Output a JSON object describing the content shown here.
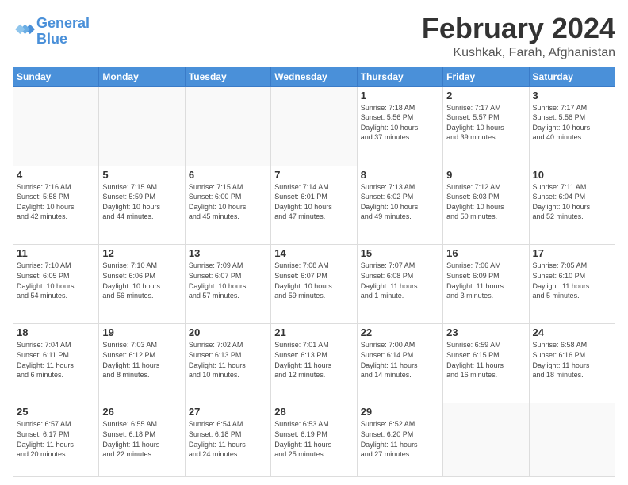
{
  "header": {
    "logo_line1": "General",
    "logo_line2": "Blue",
    "month_title": "February 2024",
    "location": "Kushkak, Farah, Afghanistan"
  },
  "calendar": {
    "days_of_week": [
      "Sunday",
      "Monday",
      "Tuesday",
      "Wednesday",
      "Thursday",
      "Friday",
      "Saturday"
    ],
    "weeks": [
      [
        {
          "day": "",
          "info": ""
        },
        {
          "day": "",
          "info": ""
        },
        {
          "day": "",
          "info": ""
        },
        {
          "day": "",
          "info": ""
        },
        {
          "day": "1",
          "info": "Sunrise: 7:18 AM\nSunset: 5:56 PM\nDaylight: 10 hours\nand 37 minutes."
        },
        {
          "day": "2",
          "info": "Sunrise: 7:17 AM\nSunset: 5:57 PM\nDaylight: 10 hours\nand 39 minutes."
        },
        {
          "day": "3",
          "info": "Sunrise: 7:17 AM\nSunset: 5:58 PM\nDaylight: 10 hours\nand 40 minutes."
        }
      ],
      [
        {
          "day": "4",
          "info": "Sunrise: 7:16 AM\nSunset: 5:58 PM\nDaylight: 10 hours\nand 42 minutes."
        },
        {
          "day": "5",
          "info": "Sunrise: 7:15 AM\nSunset: 5:59 PM\nDaylight: 10 hours\nand 44 minutes."
        },
        {
          "day": "6",
          "info": "Sunrise: 7:15 AM\nSunset: 6:00 PM\nDaylight: 10 hours\nand 45 minutes."
        },
        {
          "day": "7",
          "info": "Sunrise: 7:14 AM\nSunset: 6:01 PM\nDaylight: 10 hours\nand 47 minutes."
        },
        {
          "day": "8",
          "info": "Sunrise: 7:13 AM\nSunset: 6:02 PM\nDaylight: 10 hours\nand 49 minutes."
        },
        {
          "day": "9",
          "info": "Sunrise: 7:12 AM\nSunset: 6:03 PM\nDaylight: 10 hours\nand 50 minutes."
        },
        {
          "day": "10",
          "info": "Sunrise: 7:11 AM\nSunset: 6:04 PM\nDaylight: 10 hours\nand 52 minutes."
        }
      ],
      [
        {
          "day": "11",
          "info": "Sunrise: 7:10 AM\nSunset: 6:05 PM\nDaylight: 10 hours\nand 54 minutes."
        },
        {
          "day": "12",
          "info": "Sunrise: 7:10 AM\nSunset: 6:06 PM\nDaylight: 10 hours\nand 56 minutes."
        },
        {
          "day": "13",
          "info": "Sunrise: 7:09 AM\nSunset: 6:07 PM\nDaylight: 10 hours\nand 57 minutes."
        },
        {
          "day": "14",
          "info": "Sunrise: 7:08 AM\nSunset: 6:07 PM\nDaylight: 10 hours\nand 59 minutes."
        },
        {
          "day": "15",
          "info": "Sunrise: 7:07 AM\nSunset: 6:08 PM\nDaylight: 11 hours\nand 1 minute."
        },
        {
          "day": "16",
          "info": "Sunrise: 7:06 AM\nSunset: 6:09 PM\nDaylight: 11 hours\nand 3 minutes."
        },
        {
          "day": "17",
          "info": "Sunrise: 7:05 AM\nSunset: 6:10 PM\nDaylight: 11 hours\nand 5 minutes."
        }
      ],
      [
        {
          "day": "18",
          "info": "Sunrise: 7:04 AM\nSunset: 6:11 PM\nDaylight: 11 hours\nand 6 minutes."
        },
        {
          "day": "19",
          "info": "Sunrise: 7:03 AM\nSunset: 6:12 PM\nDaylight: 11 hours\nand 8 minutes."
        },
        {
          "day": "20",
          "info": "Sunrise: 7:02 AM\nSunset: 6:13 PM\nDaylight: 11 hours\nand 10 minutes."
        },
        {
          "day": "21",
          "info": "Sunrise: 7:01 AM\nSunset: 6:13 PM\nDaylight: 11 hours\nand 12 minutes."
        },
        {
          "day": "22",
          "info": "Sunrise: 7:00 AM\nSunset: 6:14 PM\nDaylight: 11 hours\nand 14 minutes."
        },
        {
          "day": "23",
          "info": "Sunrise: 6:59 AM\nSunset: 6:15 PM\nDaylight: 11 hours\nand 16 minutes."
        },
        {
          "day": "24",
          "info": "Sunrise: 6:58 AM\nSunset: 6:16 PM\nDaylight: 11 hours\nand 18 minutes."
        }
      ],
      [
        {
          "day": "25",
          "info": "Sunrise: 6:57 AM\nSunset: 6:17 PM\nDaylight: 11 hours\nand 20 minutes."
        },
        {
          "day": "26",
          "info": "Sunrise: 6:55 AM\nSunset: 6:18 PM\nDaylight: 11 hours\nand 22 minutes."
        },
        {
          "day": "27",
          "info": "Sunrise: 6:54 AM\nSunset: 6:18 PM\nDaylight: 11 hours\nand 24 minutes."
        },
        {
          "day": "28",
          "info": "Sunrise: 6:53 AM\nSunset: 6:19 PM\nDaylight: 11 hours\nand 25 minutes."
        },
        {
          "day": "29",
          "info": "Sunrise: 6:52 AM\nSunset: 6:20 PM\nDaylight: 11 hours\nand 27 minutes."
        },
        {
          "day": "",
          "info": ""
        },
        {
          "day": "",
          "info": ""
        }
      ]
    ]
  }
}
